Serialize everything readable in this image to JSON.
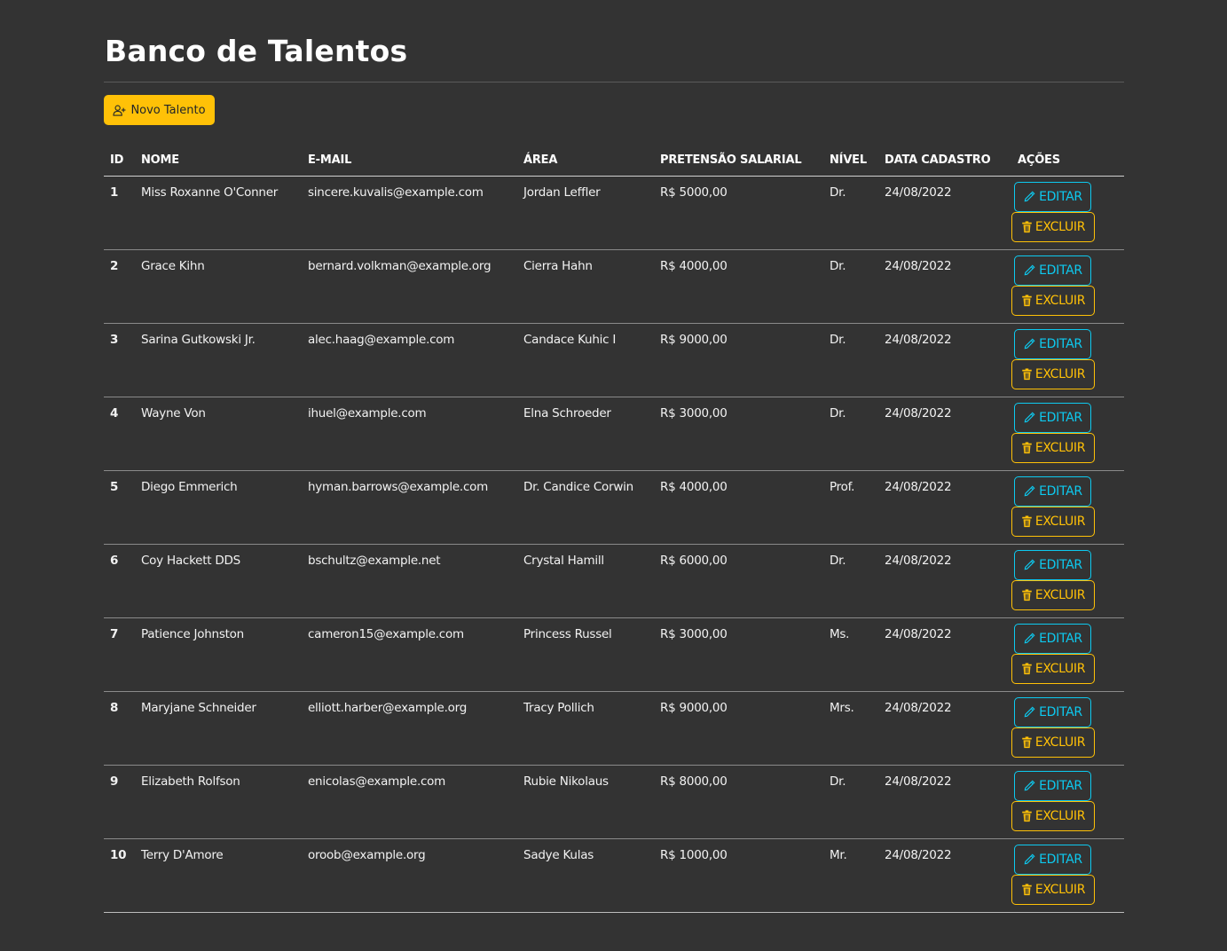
{
  "page": {
    "title": "Banco de Talentos",
    "new_button_label": "Novo Talento"
  },
  "colors": {
    "background": "#333333",
    "primary_warning": "#ffc107",
    "info": "#0dcaf0",
    "text": "#ffffff"
  },
  "table": {
    "headers": [
      "ID",
      "NOME",
      "E-MAIL",
      "ÁREA",
      "PRETENSÃO SALARIAL",
      "NÍVEL",
      "DATA CADASTRO",
      "AÇÕES"
    ],
    "edit_label": "EDITAR",
    "delete_label": "EXCLUIR",
    "rows": [
      {
        "id": "1",
        "nome": "Miss Roxanne O'Conner",
        "email": "sincere.kuvalis@example.com",
        "area": "Jordan Leffler",
        "salario": "R$ 5000,00",
        "nivel": "Dr.",
        "data": "24/08/2022"
      },
      {
        "id": "2",
        "nome": "Grace Kihn",
        "email": "bernard.volkman@example.org",
        "area": "Cierra Hahn",
        "salario": "R$ 4000,00",
        "nivel": "Dr.",
        "data": "24/08/2022"
      },
      {
        "id": "3",
        "nome": "Sarina Gutkowski Jr.",
        "email": "alec.haag@example.com",
        "area": "Candace Kuhic I",
        "salario": "R$ 9000,00",
        "nivel": "Dr.",
        "data": "24/08/2022"
      },
      {
        "id": "4",
        "nome": "Wayne Von",
        "email": "ihuel@example.com",
        "area": "Elna Schroeder",
        "salario": "R$ 3000,00",
        "nivel": "Dr.",
        "data": "24/08/2022"
      },
      {
        "id": "5",
        "nome": "Diego Emmerich",
        "email": "hyman.barrows@example.com",
        "area": "Dr. Candice Corwin",
        "salario": "R$ 4000,00",
        "nivel": "Prof.",
        "data": "24/08/2022"
      },
      {
        "id": "6",
        "nome": "Coy Hackett DDS",
        "email": "bschultz@example.net",
        "area": "Crystal Hamill",
        "salario": "R$ 6000,00",
        "nivel": "Dr.",
        "data": "24/08/2022"
      },
      {
        "id": "7",
        "nome": "Patience Johnston",
        "email": "cameron15@example.com",
        "area": "Princess Russel",
        "salario": "R$ 3000,00",
        "nivel": "Ms.",
        "data": "24/08/2022"
      },
      {
        "id": "8",
        "nome": "Maryjane Schneider",
        "email": "elliott.harber@example.org",
        "area": "Tracy Pollich",
        "salario": "R$ 9000,00",
        "nivel": "Mrs.",
        "data": "24/08/2022"
      },
      {
        "id": "9",
        "nome": "Elizabeth Rolfson",
        "email": "enicolas@example.com",
        "area": "Rubie Nikolaus",
        "salario": "R$ 8000,00",
        "nivel": "Dr.",
        "data": "24/08/2022"
      },
      {
        "id": "10",
        "nome": "Terry D'Amore",
        "email": "oroob@example.org",
        "area": "Sadye Kulas",
        "salario": "R$ 1000,00",
        "nivel": "Mr.",
        "data": "24/08/2022"
      }
    ]
  },
  "icons": {
    "new_button": "person-plus-icon",
    "edit": "pencil-icon",
    "delete": "trash-icon"
  }
}
